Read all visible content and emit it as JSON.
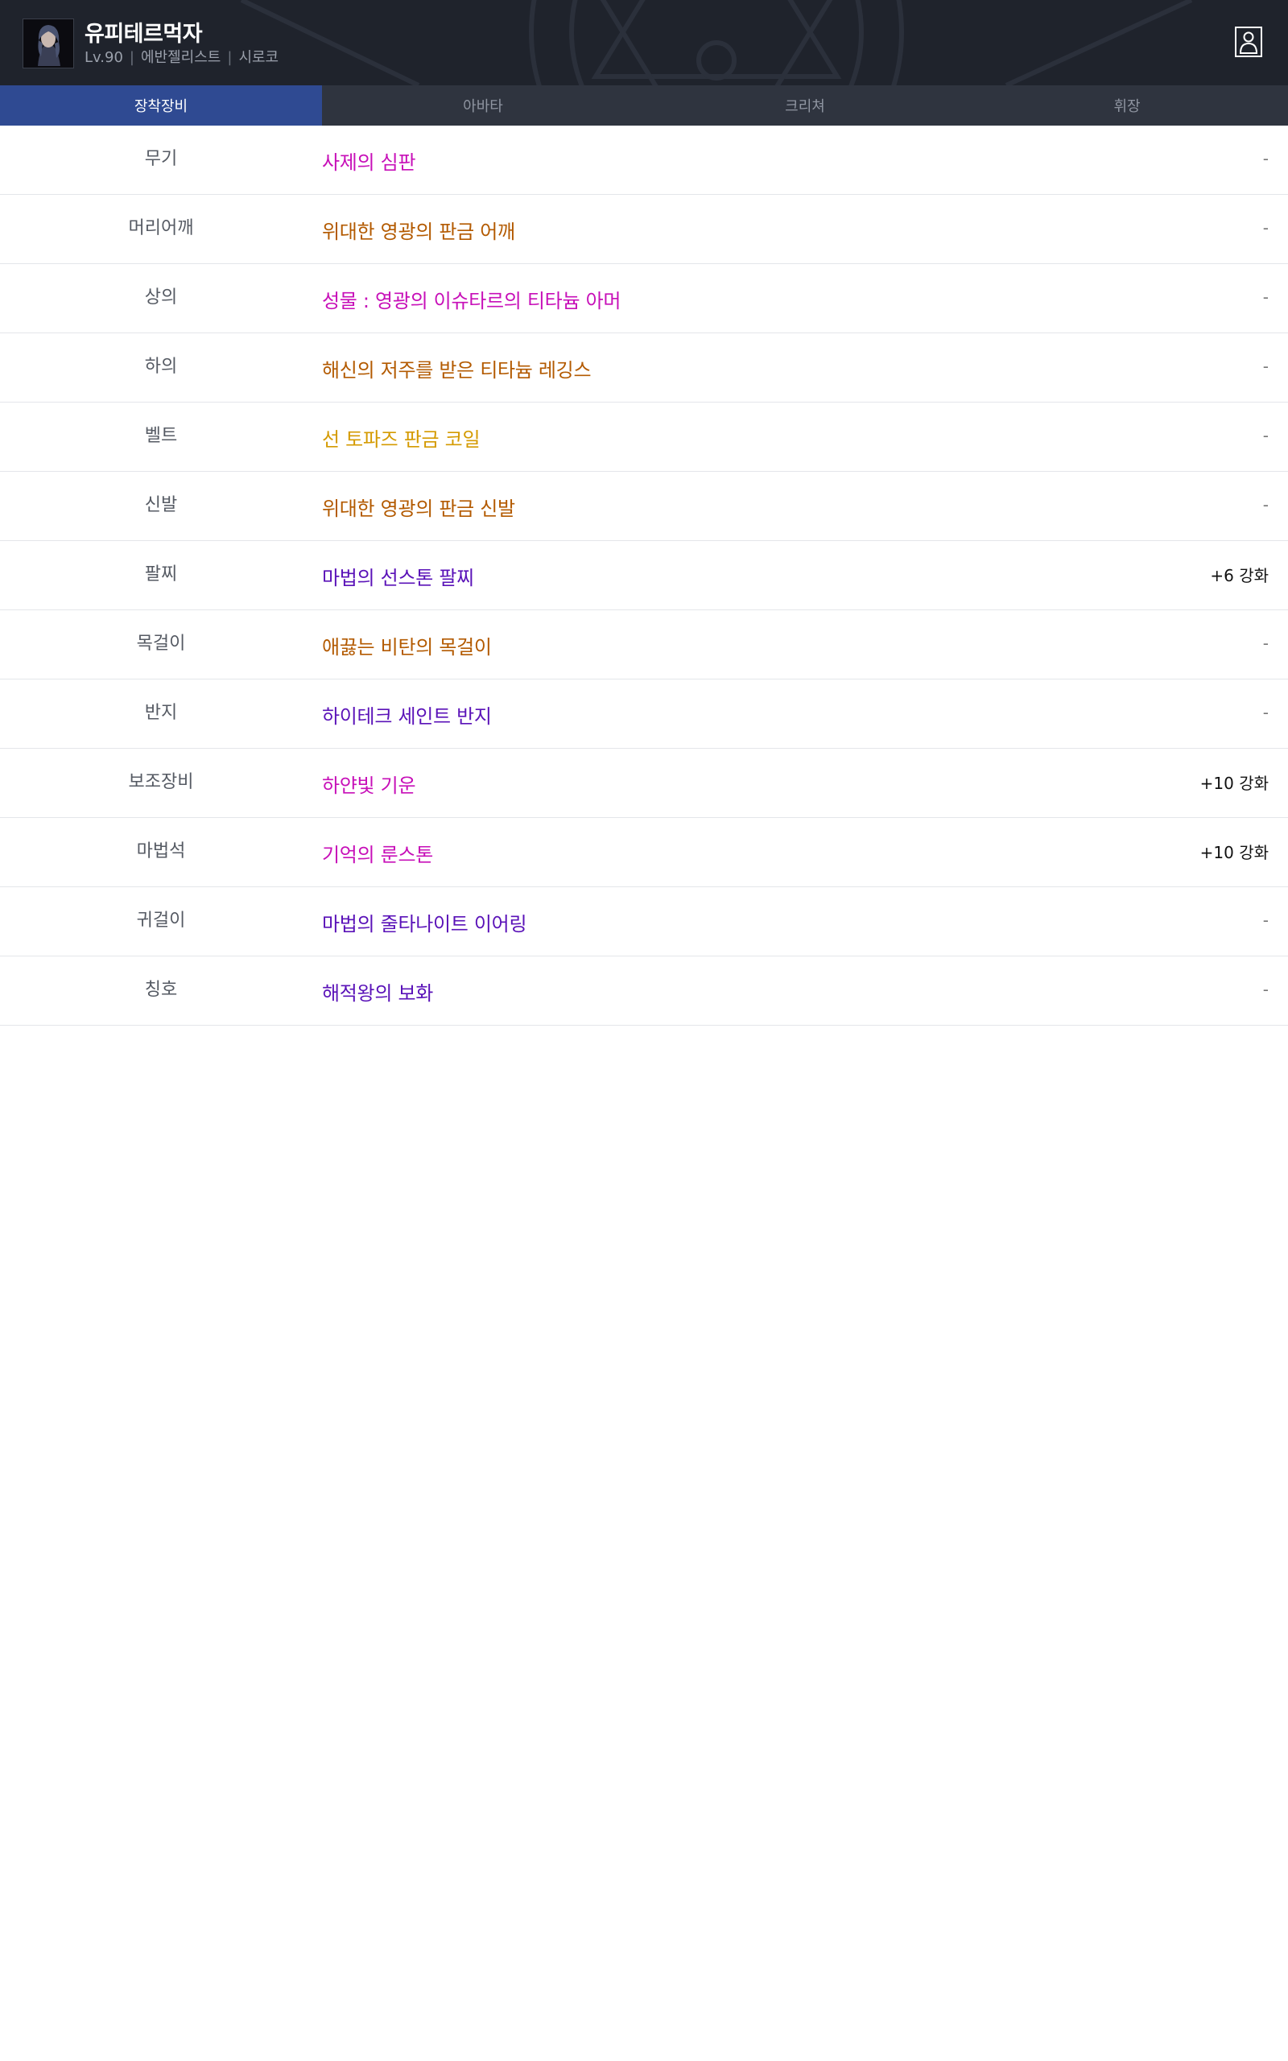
{
  "header": {
    "character_name": "유피테르먹자",
    "level": "Lv.90",
    "job": "에반젤리스트",
    "server": "시로코",
    "separator": "|",
    "avatar_icon": "character-portrait",
    "profile_icon": "person-icon"
  },
  "tabs": [
    {
      "label": "장착장비",
      "active": true
    },
    {
      "label": "아바타",
      "active": false
    },
    {
      "label": "크리쳐",
      "active": false
    },
    {
      "label": "휘장",
      "active": false
    }
  ],
  "rarity_colors": {
    "epic": "#c23bb6",
    "legendary": "#b8731a",
    "unique": "#c7279c",
    "rare": "#5e1fb5",
    "gold": "#d2a01a"
  },
  "equipment": [
    {
      "slot": "무기",
      "item": "사제의 심판",
      "color": "#c70fb8",
      "enhance": "-"
    },
    {
      "slot": "머리어깨",
      "item": "위대한 영광의 판금 어깨",
      "color": "#b35a00",
      "enhance": "-"
    },
    {
      "slot": "상의",
      "item": "성물 : 영광의 이슈타르의 티타늄 아머",
      "color": "#c70fb8",
      "enhance": "-"
    },
    {
      "slot": "하의",
      "item": "해신의 저주를 받은 티타늄 레깅스",
      "color": "#b35a00",
      "enhance": "-"
    },
    {
      "slot": "벨트",
      "item": "선 토파즈 판금 코일",
      "color": "#d49a00",
      "enhance": "-"
    },
    {
      "slot": "신발",
      "item": "위대한 영광의 판금 신발",
      "color": "#b35a00",
      "enhance": "-"
    },
    {
      "slot": "팔찌",
      "item": "마법의 선스톤 팔찌",
      "color": "#5a12b8",
      "enhance": "+6 강화"
    },
    {
      "slot": "목걸이",
      "item": "애끓는 비탄의 목걸이",
      "color": "#b35a00",
      "enhance": "-"
    },
    {
      "slot": "반지",
      "item": "하이테크 세인트 반지",
      "color": "#5a12b8",
      "enhance": "-"
    },
    {
      "slot": "보조장비",
      "item": "하얀빛 기운",
      "color": "#c70fb8",
      "enhance": "+10 강화"
    },
    {
      "slot": "마법석",
      "item": "기억의 룬스톤",
      "color": "#c70fb8",
      "enhance": "+10 강화"
    },
    {
      "slot": "귀걸이",
      "item": "마법의 줄타나이트 이어링",
      "color": "#5a12b8",
      "enhance": "-"
    },
    {
      "slot": "칭호",
      "item": "해적왕의 보화",
      "color": "#5a12b8",
      "enhance": "-"
    }
  ]
}
